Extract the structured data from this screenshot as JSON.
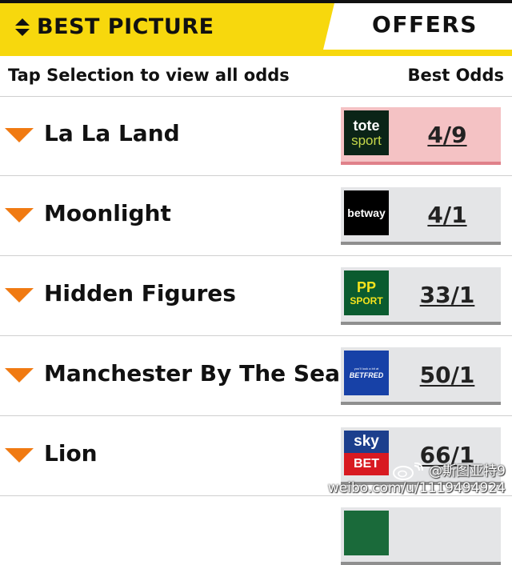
{
  "header": {
    "section_title": "BEST PICTURE",
    "offers_tab": "OFFERS",
    "accent_color": "#f7d80d",
    "sort_icon": "sort-updown-icon"
  },
  "subheader": {
    "left": "Tap Selection to view all odds",
    "right": "Best Odds"
  },
  "rows": [
    {
      "name": "La La Land",
      "bookmaker_icon": "tote-sport-logo",
      "logo_text": [
        "tote",
        "sport"
      ],
      "odds": "4/9",
      "highlighted": true
    },
    {
      "name": "Moonlight",
      "bookmaker_icon": "betway-logo",
      "logo_text": [
        "betway"
      ],
      "odds": "4/1",
      "highlighted": false
    },
    {
      "name": "Hidden Figures",
      "bookmaker_icon": "paddy-power-logo",
      "logo_text": [
        "PP",
        "SPORT"
      ],
      "odds": "33/1",
      "highlighted": false
    },
    {
      "name": "Manchester By The Sea",
      "bookmaker_icon": "betfred-logo",
      "logo_text": [
        "you'll look a bit at",
        "BETFRED"
      ],
      "odds": "50/1",
      "highlighted": false
    },
    {
      "name": "Lion",
      "bookmaker_icon": "sky-bet-logo",
      "logo_text": [
        "sky",
        "BET"
      ],
      "odds": "66/1",
      "highlighted": false
    }
  ],
  "colors": {
    "arrow": "#f07a12",
    "best_highlight": "#f4c2c4",
    "odds_button": "#e4e5e7"
  },
  "watermark": {
    "line1": "@斯图亚特9",
    "line2": "weibo.com/u/1119494924"
  }
}
